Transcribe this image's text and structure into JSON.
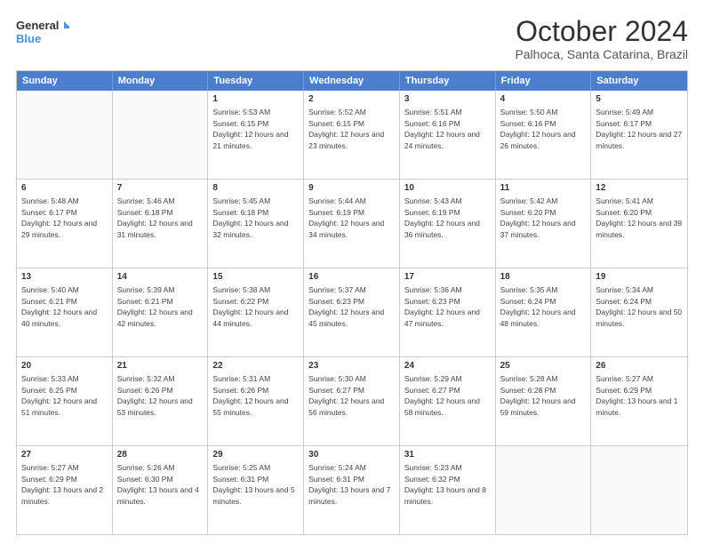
{
  "logo": {
    "line1": "General",
    "line2": "Blue"
  },
  "title": "October 2024",
  "subtitle": "Palhoca, Santa Catarina, Brazil",
  "header_days": [
    "Sunday",
    "Monday",
    "Tuesday",
    "Wednesday",
    "Thursday",
    "Friday",
    "Saturday"
  ],
  "weeks": [
    [
      {
        "day": "",
        "sunrise": "",
        "sunset": "",
        "daylight": ""
      },
      {
        "day": "",
        "sunrise": "",
        "sunset": "",
        "daylight": ""
      },
      {
        "day": "1",
        "sunrise": "Sunrise: 5:53 AM",
        "sunset": "Sunset: 6:15 PM",
        "daylight": "Daylight: 12 hours and 21 minutes."
      },
      {
        "day": "2",
        "sunrise": "Sunrise: 5:52 AM",
        "sunset": "Sunset: 6:15 PM",
        "daylight": "Daylight: 12 hours and 23 minutes."
      },
      {
        "day": "3",
        "sunrise": "Sunrise: 5:51 AM",
        "sunset": "Sunset: 6:16 PM",
        "daylight": "Daylight: 12 hours and 24 minutes."
      },
      {
        "day": "4",
        "sunrise": "Sunrise: 5:50 AM",
        "sunset": "Sunset: 6:16 PM",
        "daylight": "Daylight: 12 hours and 26 minutes."
      },
      {
        "day": "5",
        "sunrise": "Sunrise: 5:49 AM",
        "sunset": "Sunset: 6:17 PM",
        "daylight": "Daylight: 12 hours and 27 minutes."
      }
    ],
    [
      {
        "day": "6",
        "sunrise": "Sunrise: 5:48 AM",
        "sunset": "Sunset: 6:17 PM",
        "daylight": "Daylight: 12 hours and 29 minutes."
      },
      {
        "day": "7",
        "sunrise": "Sunrise: 5:46 AM",
        "sunset": "Sunset: 6:18 PM",
        "daylight": "Daylight: 12 hours and 31 minutes."
      },
      {
        "day": "8",
        "sunrise": "Sunrise: 5:45 AM",
        "sunset": "Sunset: 6:18 PM",
        "daylight": "Daylight: 12 hours and 32 minutes."
      },
      {
        "day": "9",
        "sunrise": "Sunrise: 5:44 AM",
        "sunset": "Sunset: 6:19 PM",
        "daylight": "Daylight: 12 hours and 34 minutes."
      },
      {
        "day": "10",
        "sunrise": "Sunrise: 5:43 AM",
        "sunset": "Sunset: 6:19 PM",
        "daylight": "Daylight: 12 hours and 36 minutes."
      },
      {
        "day": "11",
        "sunrise": "Sunrise: 5:42 AM",
        "sunset": "Sunset: 6:20 PM",
        "daylight": "Daylight: 12 hours and 37 minutes."
      },
      {
        "day": "12",
        "sunrise": "Sunrise: 5:41 AM",
        "sunset": "Sunset: 6:20 PM",
        "daylight": "Daylight: 12 hours and 39 minutes."
      }
    ],
    [
      {
        "day": "13",
        "sunrise": "Sunrise: 5:40 AM",
        "sunset": "Sunset: 6:21 PM",
        "daylight": "Daylight: 12 hours and 40 minutes."
      },
      {
        "day": "14",
        "sunrise": "Sunrise: 5:39 AM",
        "sunset": "Sunset: 6:21 PM",
        "daylight": "Daylight: 12 hours and 42 minutes."
      },
      {
        "day": "15",
        "sunrise": "Sunrise: 5:38 AM",
        "sunset": "Sunset: 6:22 PM",
        "daylight": "Daylight: 12 hours and 44 minutes."
      },
      {
        "day": "16",
        "sunrise": "Sunrise: 5:37 AM",
        "sunset": "Sunset: 6:23 PM",
        "daylight": "Daylight: 12 hours and 45 minutes."
      },
      {
        "day": "17",
        "sunrise": "Sunrise: 5:36 AM",
        "sunset": "Sunset: 6:23 PM",
        "daylight": "Daylight: 12 hours and 47 minutes."
      },
      {
        "day": "18",
        "sunrise": "Sunrise: 5:35 AM",
        "sunset": "Sunset: 6:24 PM",
        "daylight": "Daylight: 12 hours and 48 minutes."
      },
      {
        "day": "19",
        "sunrise": "Sunrise: 5:34 AM",
        "sunset": "Sunset: 6:24 PM",
        "daylight": "Daylight: 12 hours and 50 minutes."
      }
    ],
    [
      {
        "day": "20",
        "sunrise": "Sunrise: 5:33 AM",
        "sunset": "Sunset: 6:25 PM",
        "daylight": "Daylight: 12 hours and 51 minutes."
      },
      {
        "day": "21",
        "sunrise": "Sunrise: 5:32 AM",
        "sunset": "Sunset: 6:26 PM",
        "daylight": "Daylight: 12 hours and 53 minutes."
      },
      {
        "day": "22",
        "sunrise": "Sunrise: 5:31 AM",
        "sunset": "Sunset: 6:26 PM",
        "daylight": "Daylight: 12 hours and 55 minutes."
      },
      {
        "day": "23",
        "sunrise": "Sunrise: 5:30 AM",
        "sunset": "Sunset: 6:27 PM",
        "daylight": "Daylight: 12 hours and 56 minutes."
      },
      {
        "day": "24",
        "sunrise": "Sunrise: 5:29 AM",
        "sunset": "Sunset: 6:27 PM",
        "daylight": "Daylight: 12 hours and 58 minutes."
      },
      {
        "day": "25",
        "sunrise": "Sunrise: 5:28 AM",
        "sunset": "Sunset: 6:28 PM",
        "daylight": "Daylight: 12 hours and 59 minutes."
      },
      {
        "day": "26",
        "sunrise": "Sunrise: 5:27 AM",
        "sunset": "Sunset: 6:29 PM",
        "daylight": "Daylight: 13 hours and 1 minute."
      }
    ],
    [
      {
        "day": "27",
        "sunrise": "Sunrise: 5:27 AM",
        "sunset": "Sunset: 6:29 PM",
        "daylight": "Daylight: 13 hours and 2 minutes."
      },
      {
        "day": "28",
        "sunrise": "Sunrise: 5:26 AM",
        "sunset": "Sunset: 6:30 PM",
        "daylight": "Daylight: 13 hours and 4 minutes."
      },
      {
        "day": "29",
        "sunrise": "Sunrise: 5:25 AM",
        "sunset": "Sunset: 6:31 PM",
        "daylight": "Daylight: 13 hours and 5 minutes."
      },
      {
        "day": "30",
        "sunrise": "Sunrise: 5:24 AM",
        "sunset": "Sunset: 6:31 PM",
        "daylight": "Daylight: 13 hours and 7 minutes."
      },
      {
        "day": "31",
        "sunrise": "Sunrise: 5:23 AM",
        "sunset": "Sunset: 6:32 PM",
        "daylight": "Daylight: 13 hours and 8 minutes."
      },
      {
        "day": "",
        "sunrise": "",
        "sunset": "",
        "daylight": ""
      },
      {
        "day": "",
        "sunrise": "",
        "sunset": "",
        "daylight": ""
      }
    ]
  ]
}
